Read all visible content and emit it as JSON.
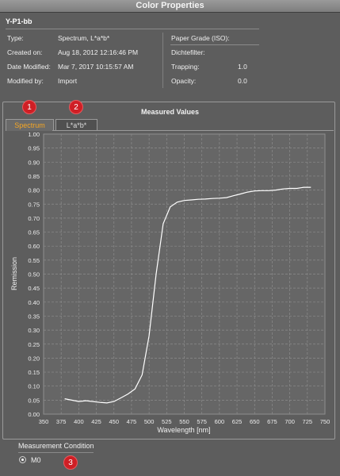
{
  "window": {
    "title": "Color Properties"
  },
  "color_name": "Y-P1-bb",
  "properties_left": [
    {
      "label": "Type:",
      "value": "Spectrum, L*a*b*"
    },
    {
      "label": "Created on:",
      "value": "Aug 18, 2012 12:16:46 PM"
    },
    {
      "label": "Date Modified:",
      "value": "Mar 7, 2017 10:15:57 AM"
    },
    {
      "label": "Modified by:",
      "value": "Import"
    }
  ],
  "properties_right": [
    {
      "label": "Paper Grade (ISO):",
      "value": ""
    },
    {
      "label": "Dichtefilter:",
      "value": ""
    },
    {
      "label": "Trapping:",
      "value": "1.0"
    },
    {
      "label": "Opacity:",
      "value": "0.0"
    }
  ],
  "measured": {
    "title": "Measured Values",
    "tabs": [
      {
        "label": "Spectrum",
        "active": true
      },
      {
        "label": "L*a*b*",
        "active": false
      }
    ]
  },
  "badges": [
    "1",
    "2",
    "3"
  ],
  "measurement_condition": {
    "label": "Measurement Condition",
    "selected": "M0"
  },
  "colors": {
    "background": "#5d5d5d",
    "active_tab_text": "#f5a623",
    "badge": "#cf1f25",
    "curve": "#ffffff"
  },
  "chart_data": {
    "type": "line",
    "xlabel": "Wavelength [nm]",
    "ylabel": "Remission",
    "xlim": [
      350,
      750
    ],
    "ylim": [
      0,
      1
    ],
    "x_ticks": [
      "350",
      "375",
      "400",
      "425",
      "450",
      "475",
      "500",
      "525",
      "550",
      "575",
      "600",
      "625",
      "650",
      "675",
      "700",
      "725",
      "750"
    ],
    "y_ticks": [
      "0.00",
      "0.05",
      "0.10",
      "0.15",
      "0.20",
      "0.25",
      "0.30",
      "0.35",
      "0.40",
      "0.45",
      "0.50",
      "0.55",
      "0.60",
      "0.65",
      "0.70",
      "0.75",
      "0.80",
      "0.85",
      "0.90",
      "0.95",
      "1.00"
    ],
    "grid": true,
    "series": [
      {
        "x": [
          380,
          390,
          400,
          410,
          420,
          430,
          440,
          450,
          460,
          470,
          480,
          490,
          500,
          510,
          520,
          530,
          540,
          550,
          560,
          570,
          580,
          590,
          600,
          610,
          620,
          630,
          640,
          650,
          660,
          670,
          680,
          690,
          700,
          710,
          720,
          730
        ],
        "y": [
          0.055,
          0.05,
          0.045,
          0.048,
          0.045,
          0.042,
          0.04,
          0.045,
          0.058,
          0.072,
          0.09,
          0.14,
          0.28,
          0.5,
          0.68,
          0.74,
          0.757,
          0.763,
          0.765,
          0.767,
          0.768,
          0.77,
          0.771,
          0.773,
          0.78,
          0.786,
          0.793,
          0.797,
          0.798,
          0.798,
          0.8,
          0.804,
          0.806,
          0.806,
          0.81,
          0.81
        ]
      }
    ]
  }
}
